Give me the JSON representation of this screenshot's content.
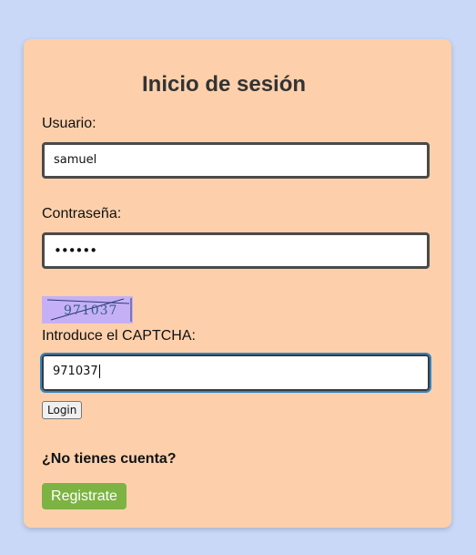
{
  "form": {
    "title": "Inicio de sesión",
    "username_label": "Usuario:",
    "username_value": "samuel",
    "password_label": "Contraseña:",
    "password_value": "••••••",
    "captcha_image_text": "971037",
    "captcha_label": "Introduce el CAPTCHA:",
    "captcha_value": "971037",
    "login_label": "Login"
  },
  "signup": {
    "prompt": "¿No tienes cuenta?",
    "register_label": "Registrate"
  },
  "colors": {
    "page_background": "#c9d8f7",
    "card_background": "#fdd0ab",
    "register_button": "#7cb342",
    "captcha_background": "#c6b0f5",
    "focus_ring": "#2e86c9"
  }
}
